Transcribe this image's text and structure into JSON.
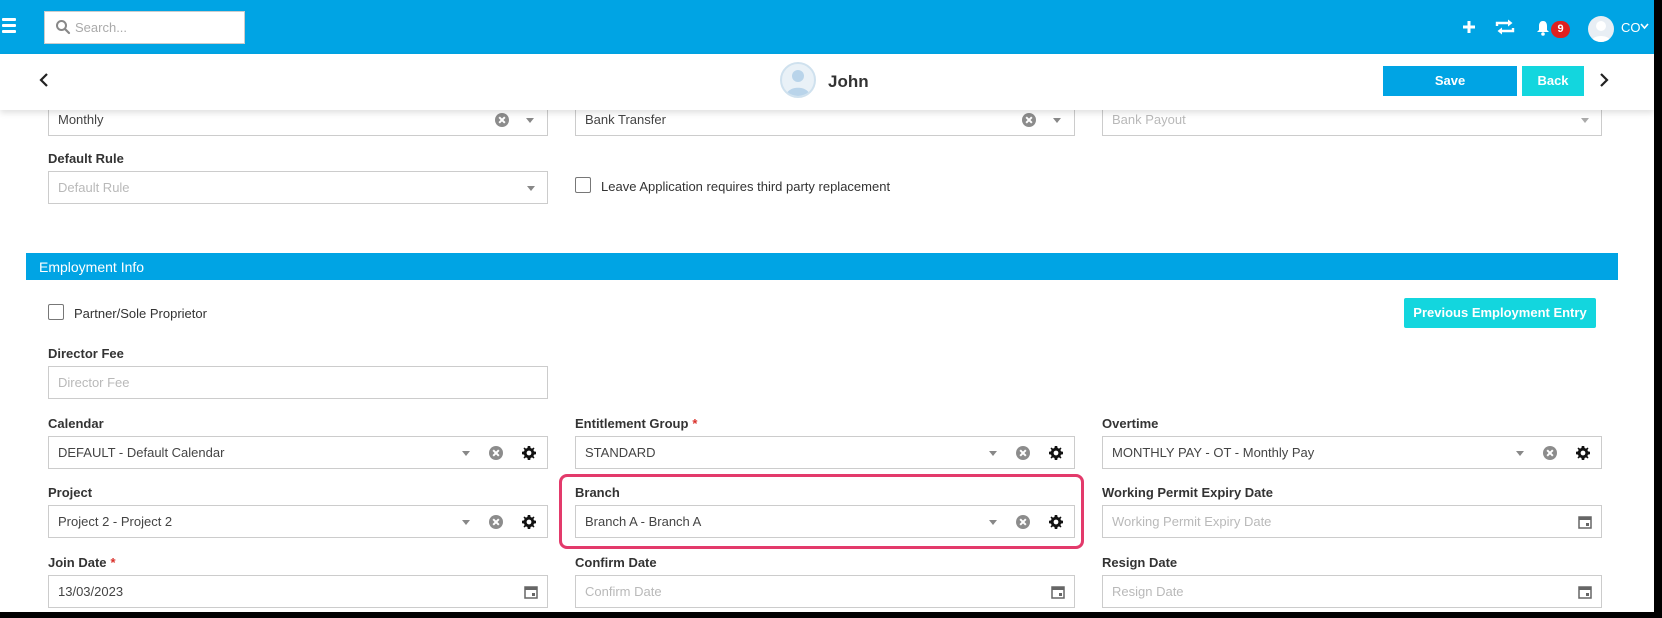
{
  "topbar": {
    "search_placeholder": "Search...",
    "notification_count": "9",
    "user_initials": "CO",
    "brand_color": "#00a4e4"
  },
  "header": {
    "title": "John",
    "save_label": "Save",
    "back_label": "Back"
  },
  "payment": {
    "frequency": "Monthly",
    "method": "Bank Transfer",
    "payout_placeholder": "Bank Payout"
  },
  "default_rule": {
    "label": "Default Rule",
    "placeholder": "Default Rule"
  },
  "leave_replacement": {
    "label": "Leave Application requires third party replacement",
    "checked": false
  },
  "employment": {
    "section_title": "Employment Info",
    "partner_label": "Partner/Sole Proprietor",
    "partner_checked": false,
    "previous_entry_label": "Previous Employment Entry",
    "director_fee": {
      "label": "Director Fee",
      "placeholder": "Director Fee"
    },
    "calendar": {
      "label": "Calendar",
      "value": "DEFAULT - Default Calendar"
    },
    "entitlement_group": {
      "label": "Entitlement Group",
      "value": "STANDARD",
      "required": "*"
    },
    "overtime": {
      "label": "Overtime",
      "value": "MONTHLY PAY - OT - Monthly Pay"
    },
    "project": {
      "label": "Project",
      "value": "Project 2 - Project 2"
    },
    "branch": {
      "label": "Branch",
      "value": "Branch A - Branch A"
    },
    "permit_expiry": {
      "label": "Working Permit Expiry Date",
      "placeholder": "Working Permit Expiry Date"
    },
    "join_date": {
      "label": "Join Date",
      "value": "13/03/2023",
      "required": "*"
    },
    "confirm_date": {
      "label": "Confirm Date",
      "placeholder": "Confirm Date"
    },
    "resign_date": {
      "label": "Resign Date",
      "placeholder": "Resign Date"
    }
  },
  "icons": {
    "menu": "hamburger-icon",
    "search": "search-icon",
    "add": "plus-icon",
    "switch": "swap-icon",
    "notifications": "bell-icon",
    "settings": "gear-icon",
    "date": "calendar-icon"
  }
}
